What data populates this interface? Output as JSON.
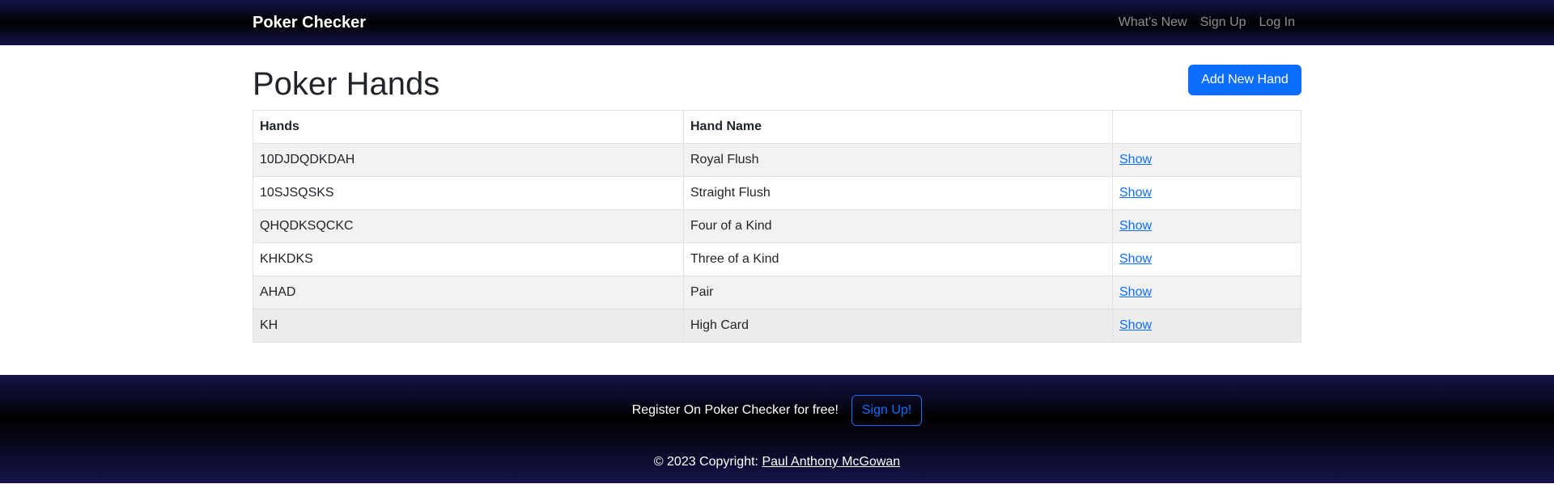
{
  "navbar": {
    "brand": "Poker Checker",
    "links": [
      "What's New",
      "Sign Up",
      "Log In"
    ]
  },
  "main": {
    "title": "Poker Hands",
    "add_button_label": "Add New Hand",
    "table": {
      "headers": [
        "Hands",
        "Hand Name",
        ""
      ],
      "rows": [
        {
          "hand": "10DJDQDKDAH",
          "name": "Royal Flush",
          "action": "Show"
        },
        {
          "hand": "10SJSQSKS",
          "name": "Straight Flush",
          "action": "Show"
        },
        {
          "hand": "QHQDKSQCKC",
          "name": "Four of a Kind",
          "action": "Show"
        },
        {
          "hand": "KHKDKS",
          "name": "Three of a Kind",
          "action": "Show"
        },
        {
          "hand": "AHAD",
          "name": "Pair",
          "action": "Show"
        },
        {
          "hand": "KH",
          "name": "High Card",
          "action": "Show"
        }
      ]
    }
  },
  "footer": {
    "cta_text": "Register On Poker Checker for free!",
    "cta_button": "Sign Up!",
    "copyright_prefix": "© 2023 Copyright:",
    "author": "Paul Anthony McGowan"
  },
  "colors": {
    "primary": "#0d6efd",
    "nav_gradient_edge": "#14144a",
    "nav_gradient_center": "#000000"
  }
}
